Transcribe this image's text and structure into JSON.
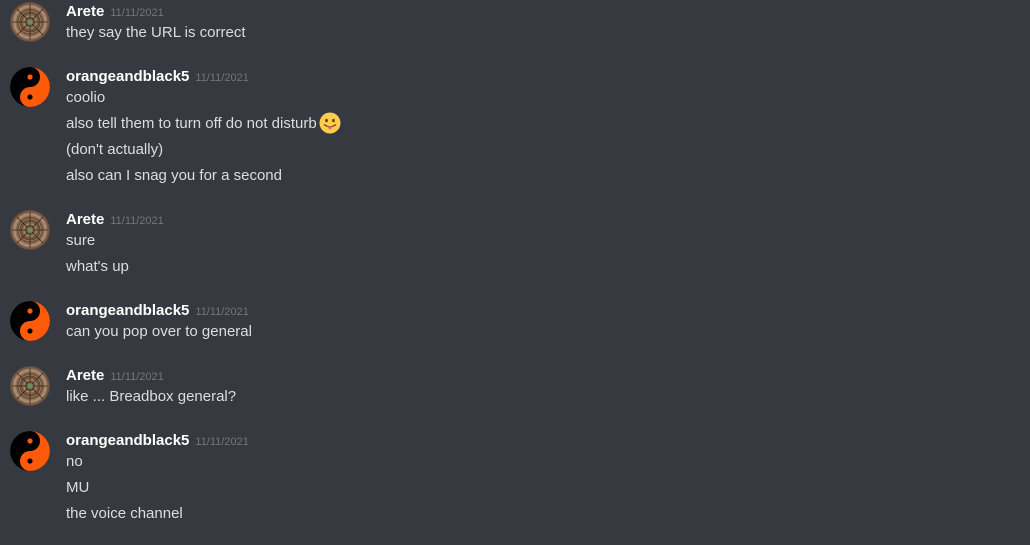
{
  "users": {
    "arete": {
      "name": "Arete",
      "avatar": "mandala-avatar-icon"
    },
    "orange": {
      "name": "orangeandblack5",
      "avatar": "yin-yang-avatar-icon"
    }
  },
  "colors": {
    "background": "#36393f",
    "username": "#ffffff",
    "text": "#dcddde",
    "timestamp": "#72767d",
    "orange": "#ff5a0a"
  },
  "groups": [
    {
      "user": "Arete",
      "timestamp": "11/11/2021",
      "lines": [
        "they say the URL is correct"
      ]
    },
    {
      "user": "orangeandblack5",
      "timestamp": "11/11/2021",
      "lines": [
        "coolio",
        "also tell them to turn off do not disturb",
        "(don't actually)",
        "also can I snag you for a second"
      ],
      "emoji": "tongue-out-emoji-icon"
    },
    {
      "user": "Arete",
      "timestamp": "11/11/2021",
      "lines": [
        "sure",
        "what's up"
      ]
    },
    {
      "user": "orangeandblack5",
      "timestamp": "11/11/2021",
      "lines": [
        "can you pop over to general"
      ]
    },
    {
      "user": "Arete",
      "timestamp": "11/11/2021",
      "lines": [
        "like ... Breadbox general?"
      ]
    },
    {
      "user": "orangeandblack5",
      "timestamp": "11/11/2021",
      "lines": [
        "no",
        "MU",
        "the voice channel"
      ]
    }
  ]
}
